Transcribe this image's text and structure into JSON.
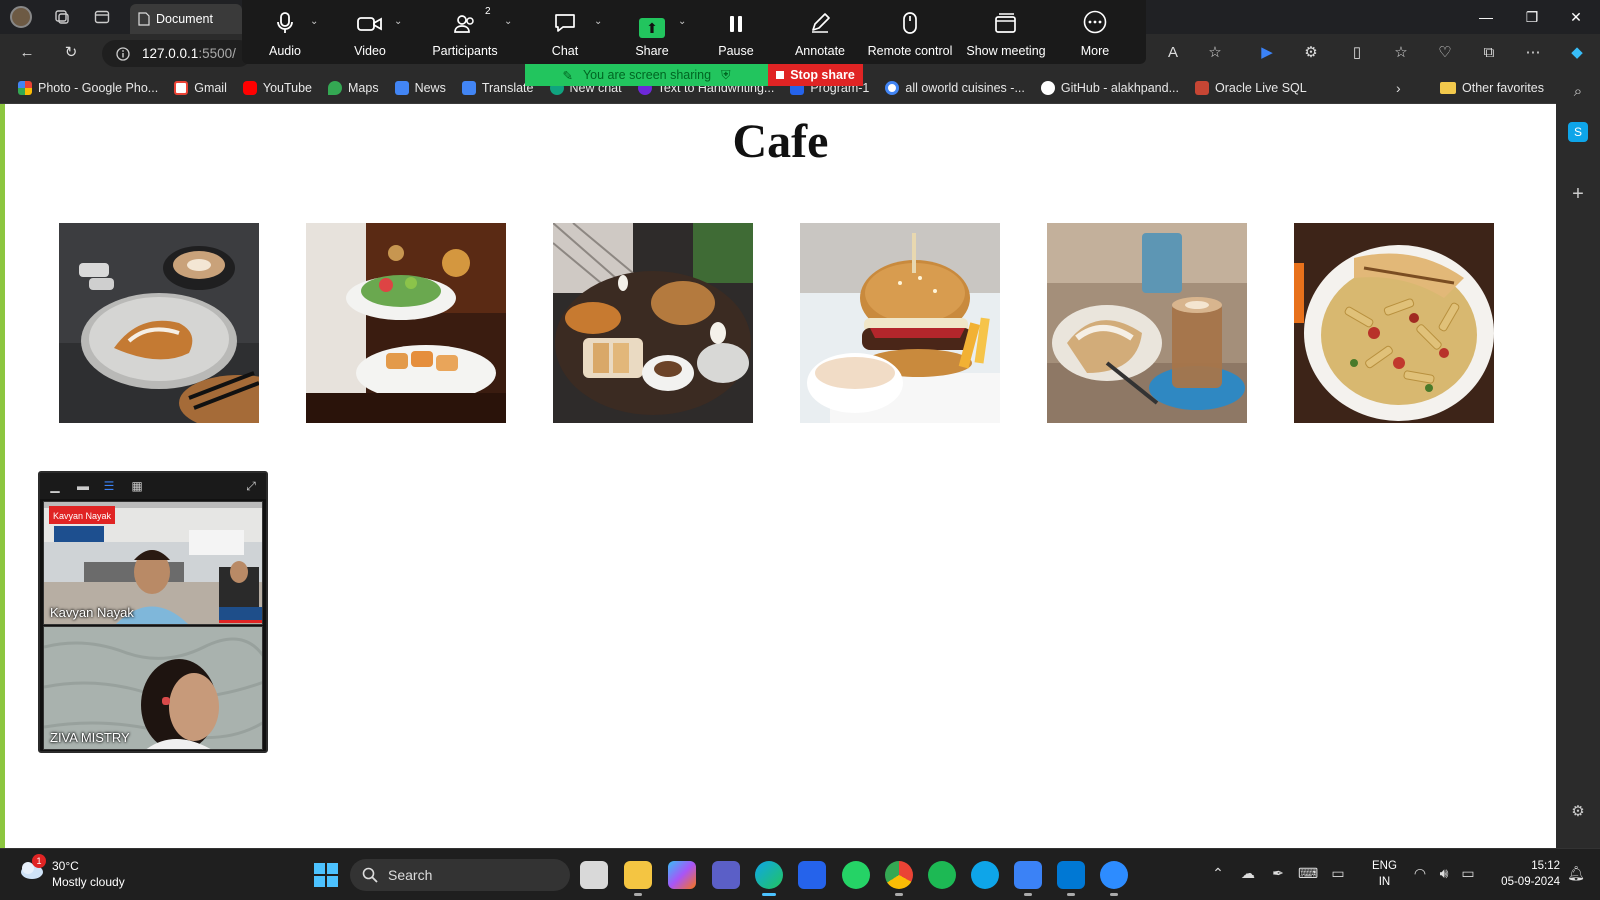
{
  "browser": {
    "tab_title": "Document",
    "url_host": "127.0.0.1",
    "url_port": ":5500/",
    "favorites": [
      {
        "label": "Photo - Google Pho...",
        "color": "#ea4335"
      },
      {
        "label": "Gmail",
        "color": "#ea4335"
      },
      {
        "label": "YouTube",
        "color": "#ff0000"
      },
      {
        "label": "Maps",
        "color": "#34a853"
      },
      {
        "label": "News",
        "color": "#4285f4"
      },
      {
        "label": "Translate",
        "color": "#4285f4"
      },
      {
        "label": "New chat",
        "color": "#10a37f"
      },
      {
        "label": "Text to Handwriting...",
        "color": "#6d28d9"
      },
      {
        "label": "Program-1",
        "color": "#2563eb"
      },
      {
        "label": "all oworld cuisines -...",
        "color": "#ffffff"
      },
      {
        "label": "GitHub - alakhpand...",
        "color": "#ffffff"
      },
      {
        "label": "Oracle Live SQL",
        "color": "#c74634"
      }
    ],
    "other_favorites": "Other favorites"
  },
  "zoom": {
    "buttons": [
      {
        "label": "Audio",
        "icon": "microphone-icon"
      },
      {
        "label": "Video",
        "icon": "camera-icon"
      },
      {
        "label": "Participants",
        "icon": "people-icon",
        "count": "2"
      },
      {
        "label": "Chat",
        "icon": "chat-icon"
      },
      {
        "label": "Share",
        "icon": "share-icon"
      },
      {
        "label": "Pause",
        "icon": "pause-icon"
      },
      {
        "label": "Annotate",
        "icon": "pen-icon"
      },
      {
        "label": "Remote control",
        "icon": "mouse-icon"
      },
      {
        "label": "Show meeting",
        "icon": "window-icon"
      },
      {
        "label": "More",
        "icon": "more-icon"
      }
    ],
    "sharing_status": "You are screen sharing",
    "stop_share": "Stop share"
  },
  "page": {
    "title": "Cafe",
    "dishes": [
      {
        "name": "croissant-coffee-photo"
      },
      {
        "name": "salad-plates-photo"
      },
      {
        "name": "breakfast-spread-photo"
      },
      {
        "name": "burger-photo"
      },
      {
        "name": "latte-pastry-photo"
      },
      {
        "name": "pasta-plate-photo"
      }
    ]
  },
  "video_panel": {
    "participants": [
      {
        "name": "Kavyan Nayak"
      },
      {
        "name": "ZIVA MISTRY"
      }
    ]
  },
  "taskbar": {
    "weather_temp": "30°C",
    "weather_desc": "Mostly cloudy",
    "weather_badge": "1",
    "search_placeholder": "Search",
    "lang_1": "ENG",
    "lang_2": "IN",
    "time": "15:12",
    "date": "05-09-2024"
  }
}
